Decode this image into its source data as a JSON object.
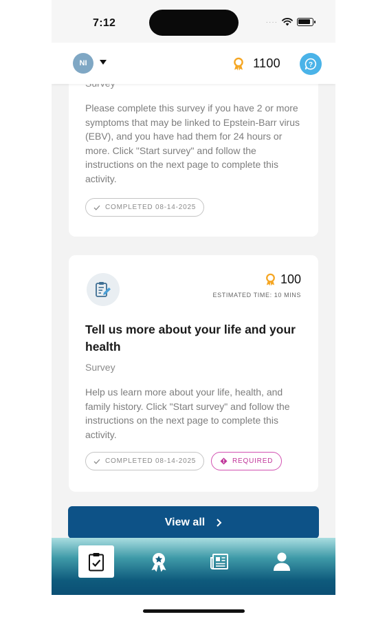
{
  "status_bar": {
    "time": "7:12",
    "signal": "····"
  },
  "header": {
    "avatar_initials": "NI",
    "points": "1100"
  },
  "cards": [
    {
      "type": "Survey",
      "description": "Please complete this survey if you have 2 or more symptoms that may be linked to Epstein-Barr virus (EBV), and you have had them for 24 hours or more. Click \"Start survey\" and follow the instructions on the next page to complete this activity.",
      "completed": "COMPLETED 08-14-2025"
    },
    {
      "reward": "100",
      "estimated_time": "ESTIMATED TIME: 10 MINS",
      "title": "Tell us more about your life and your health",
      "type": "Survey",
      "description": "Help us learn more about your life, health, and family history. Click \"Start survey\" and follow the instructions on the next page to complete this activity.",
      "completed": "COMPLETED 08-14-2025",
      "required": "REQUIRED"
    }
  ],
  "view_all_label": "View all",
  "bottom_nav": [
    {
      "icon": "clipboard-check-icon",
      "active": true
    },
    {
      "icon": "award-ribbon-icon",
      "active": false
    },
    {
      "icon": "newspaper-icon",
      "active": false
    },
    {
      "icon": "person-icon",
      "active": false
    }
  ],
  "colors": {
    "primary_button": "#0d5287",
    "help_button": "#4ab3e8",
    "points_icon": "#f5a623",
    "required_accent": "#c0359a",
    "avatar": "#7fa7c4"
  }
}
